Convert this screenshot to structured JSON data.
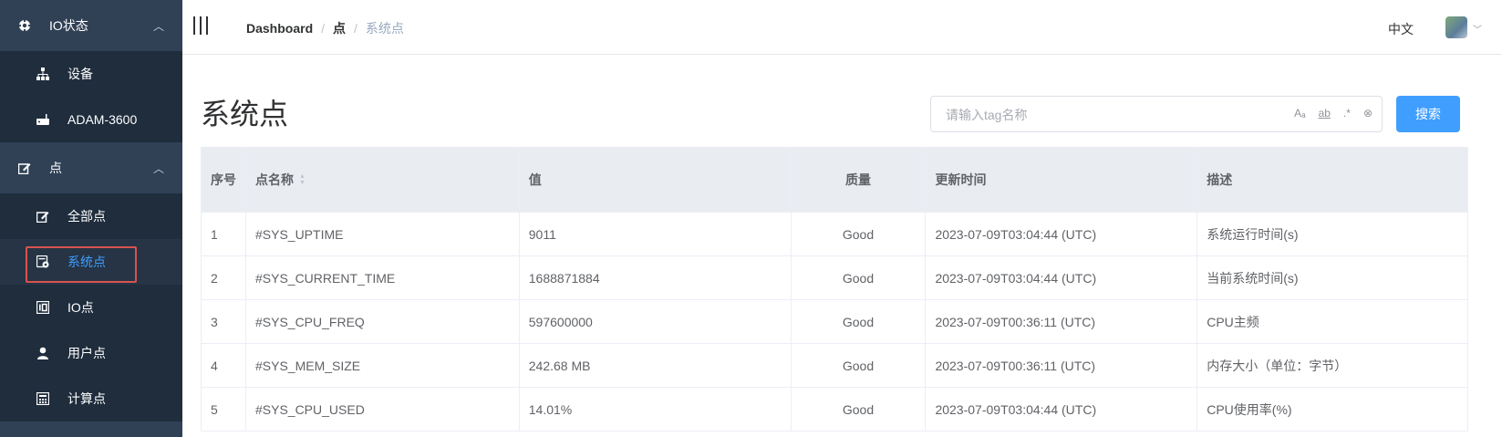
{
  "sidebar": {
    "groups": [
      {
        "label": "IO状态",
        "icon": "io-status-icon",
        "arrow": "︿"
      },
      {
        "label": "点",
        "icon": "point-edit-icon",
        "arrow": "︿"
      }
    ],
    "items": [
      {
        "label": "设备",
        "icon": "device-tree-icon"
      },
      {
        "label": "ADAM-3600",
        "icon": "router-icon"
      },
      {
        "label": "全部点",
        "icon": "all-points-icon"
      },
      {
        "label": "系统点",
        "icon": "system-points-icon"
      },
      {
        "label": "IO点",
        "icon": "io-points-icon"
      },
      {
        "label": "用户点",
        "icon": "user-points-icon"
      },
      {
        "label": "计算点",
        "icon": "calculator-icon"
      }
    ]
  },
  "header": {
    "breadcrumb": [
      "Dashboard",
      "点",
      "系统点"
    ],
    "breadcrumb_sep": "/",
    "language": "中文"
  },
  "main": {
    "title": "系统点",
    "search": {
      "placeholder": "请输入tag名称",
      "value": "",
      "icons": [
        "Aₐ",
        "ab",
        ".*",
        "⊗"
      ]
    },
    "search_button": "搜索"
  },
  "table": {
    "columns": [
      "序号",
      "点名称",
      "值",
      "质量",
      "更新时间",
      "描述"
    ],
    "rows": [
      [
        "1",
        "#SYS_UPTIME",
        "9011",
        "Good",
        "2023-07-09T03:04:44 (UTC)",
        "系统运行时间(s)"
      ],
      [
        "2",
        "#SYS_CURRENT_TIME",
        "1688871884",
        "Good",
        "2023-07-09T03:04:44 (UTC)",
        "当前系统时间(s)"
      ],
      [
        "3",
        "#SYS_CPU_FREQ",
        "597600000",
        "Good",
        "2023-07-09T00:36:11 (UTC)",
        "CPU主频"
      ],
      [
        "4",
        "#SYS_MEM_SIZE",
        "242.68 MB",
        "Good",
        "2023-07-09T00:36:11 (UTC)",
        "内存大小（单位：字节）"
      ],
      [
        "5",
        "#SYS_CPU_USED",
        "14.01%",
        "Good",
        "2023-07-09T03:04:44 (UTC)",
        "CPU使用率(%)"
      ]
    ]
  },
  "colors": {
    "sidebar_bg": "#304156",
    "accent": "#409eff",
    "highlight_box": "#d9534f"
  }
}
